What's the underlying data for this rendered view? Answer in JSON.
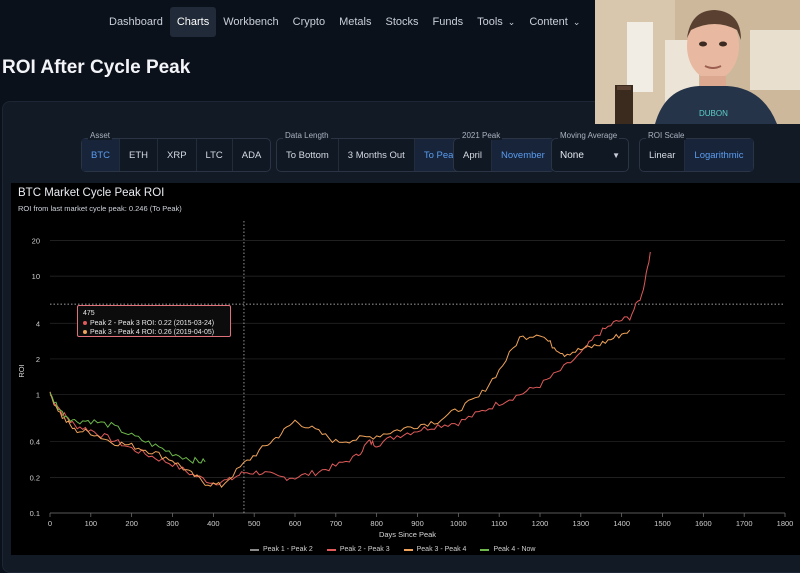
{
  "nav": {
    "items": [
      {
        "label": "Dashboard",
        "active": false
      },
      {
        "label": "Charts",
        "active": true
      },
      {
        "label": "Workbench",
        "active": false
      },
      {
        "label": "Crypto",
        "active": false
      },
      {
        "label": "Metals",
        "active": false
      },
      {
        "label": "Stocks",
        "active": false
      },
      {
        "label": "Funds",
        "active": false
      },
      {
        "label": "Tools",
        "active": false,
        "dropdown": true
      },
      {
        "label": "Content",
        "active": false,
        "dropdown": true
      }
    ]
  },
  "page": {
    "title": "ROI After Cycle Peak"
  },
  "controls": {
    "asset": {
      "label": "Asset",
      "options": [
        "BTC",
        "ETH",
        "XRP",
        "LTC",
        "ADA"
      ],
      "selected": "BTC"
    },
    "data_length": {
      "label": "Data Length",
      "options": [
        "To Bottom",
        "3 Months Out",
        "To Peak"
      ],
      "selected": "To Peak"
    },
    "peak_2021": {
      "label": "2021 Peak",
      "options": [
        "April",
        "November"
      ],
      "selected": "November"
    },
    "moving_average": {
      "label": "Moving Average",
      "value": "None"
    },
    "roi_scale": {
      "label": "ROI Scale",
      "options": [
        "Linear",
        "Logarithmic"
      ],
      "selected": "Logarithmic"
    }
  },
  "chart": {
    "title": "BTC Market Cycle Peak ROI",
    "subtitle": "ROI from last market cycle peak: 0.246 (To Peak)",
    "tooltip": {
      "header": "475",
      "lines": [
        {
          "text": "Peak 2 - Peak 3 ROI: 0.22 (2015-03-24)",
          "color": "#e05a5a"
        },
        {
          "text": "Peak 3 - Peak 4 ROI: 0.26 (2019-04-05)",
          "color": "#f0a35a"
        }
      ]
    }
  },
  "chart_data": {
    "type": "line",
    "title": "BTC Market Cycle Peak ROI",
    "xlabel": "Days Since Peak",
    "ylabel": "ROI",
    "x_ticks": [
      0,
      100,
      200,
      300,
      400,
      500,
      600,
      700,
      800,
      900,
      1000,
      1100,
      1200,
      1300,
      1400,
      1500,
      1600,
      1700,
      1800
    ],
    "y_ticks": [
      0.1,
      0.2,
      0.4,
      1,
      2,
      4,
      10,
      20
    ],
    "xlim": [
      0,
      1800
    ],
    "ylim": [
      0.1,
      25
    ],
    "y_scale": "log",
    "grid": true,
    "legend_position": "bottom",
    "colors": {
      "Peak 1 - Peak 2": "#8a8a8a",
      "Peak 2 - Peak 3": "#e05a5a",
      "Peak 3 - Peak 4": "#f0a35a",
      "Peak 4 - Now": "#6cb84a"
    },
    "series": [
      {
        "name": "Peak 1 - Peak 2",
        "points": []
      },
      {
        "name": "Peak 2 - Peak 3",
        "points": [
          [
            0,
            1
          ],
          [
            30,
            0.7
          ],
          [
            60,
            0.55
          ],
          [
            100,
            0.5
          ],
          [
            150,
            0.42
          ],
          [
            200,
            0.35
          ],
          [
            250,
            0.3
          ],
          [
            300,
            0.26
          ],
          [
            350,
            0.21
          ],
          [
            400,
            0.18
          ],
          [
            440,
            0.19
          ],
          [
            475,
            0.22
          ],
          [
            520,
            0.22
          ],
          [
            560,
            0.2
          ],
          [
            600,
            0.2
          ],
          [
            650,
            0.22
          ],
          [
            700,
            0.25
          ],
          [
            750,
            0.3
          ],
          [
            780,
            0.4
          ],
          [
            800,
            0.38
          ],
          [
            850,
            0.45
          ],
          [
            900,
            0.5
          ],
          [
            950,
            0.55
          ],
          [
            1000,
            0.58
          ],
          [
            1050,
            0.7
          ],
          [
            1100,
            0.85
          ],
          [
            1150,
            1.0
          ],
          [
            1200,
            1.2
          ],
          [
            1250,
            1.6
          ],
          [
            1300,
            2.2
          ],
          [
            1340,
            3.2
          ],
          [
            1380,
            4
          ],
          [
            1420,
            4.5
          ],
          [
            1450,
            7
          ],
          [
            1470,
            16
          ]
        ]
      },
      {
        "name": "Peak 3 - Peak 4",
        "points": [
          [
            0,
            1
          ],
          [
            30,
            0.65
          ],
          [
            60,
            0.5
          ],
          [
            100,
            0.48
          ],
          [
            150,
            0.4
          ],
          [
            200,
            0.37
          ],
          [
            250,
            0.33
          ],
          [
            300,
            0.28
          ],
          [
            340,
            0.22
          ],
          [
            380,
            0.18
          ],
          [
            420,
            0.17
          ],
          [
            475,
            0.26
          ],
          [
            520,
            0.35
          ],
          [
            560,
            0.45
          ],
          [
            600,
            0.6
          ],
          [
            650,
            0.5
          ],
          [
            700,
            0.4
          ],
          [
            750,
            0.42
          ],
          [
            800,
            0.45
          ],
          [
            850,
            0.5
          ],
          [
            900,
            0.55
          ],
          [
            950,
            0.6
          ],
          [
            1000,
            0.75
          ],
          [
            1050,
            0.95
          ],
          [
            1100,
            1.6
          ],
          [
            1150,
            3.0
          ],
          [
            1200,
            3.3
          ],
          [
            1230,
            2.6
          ],
          [
            1260,
            2.2
          ],
          [
            1300,
            2.4
          ],
          [
            1340,
            2.6
          ],
          [
            1380,
            3.0
          ],
          [
            1420,
            3.5
          ]
        ]
      },
      {
        "name": "Peak 4 - Now",
        "points": [
          [
            0,
            1
          ],
          [
            30,
            0.7
          ],
          [
            60,
            0.6
          ],
          [
            100,
            0.6
          ],
          [
            150,
            0.55
          ],
          [
            200,
            0.45
          ],
          [
            250,
            0.38
          ],
          [
            300,
            0.32
          ],
          [
            350,
            0.28
          ],
          [
            380,
            0.27
          ]
        ]
      }
    ]
  }
}
